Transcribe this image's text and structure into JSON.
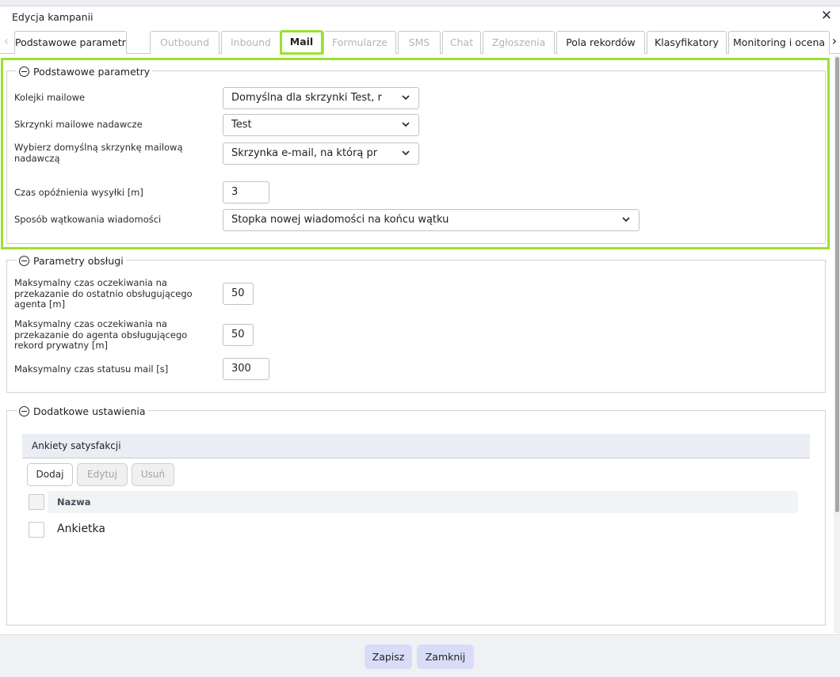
{
  "window": {
    "title": "Edycja kampanii"
  },
  "tabs": [
    {
      "label": "Podstawowe parametry",
      "state": "normal"
    },
    {
      "label": "Outbound",
      "state": "disabled"
    },
    {
      "label": "Inbound",
      "state": "disabled"
    },
    {
      "label": "Mail",
      "state": "active-highlighted"
    },
    {
      "label": "Formularze",
      "state": "disabled"
    },
    {
      "label": "SMS",
      "state": "disabled"
    },
    {
      "label": "Chat",
      "state": "disabled"
    },
    {
      "label": "Zgłoszenia",
      "state": "disabled"
    },
    {
      "label": "Pola rekordów",
      "state": "normal"
    },
    {
      "label": "Klasyfikatory",
      "state": "normal"
    },
    {
      "label": "Monitoring i ocena",
      "state": "normal"
    }
  ],
  "basic": {
    "legend": "Podstawowe parametry",
    "mail_queues_label": "Kolejki mailowe",
    "mail_queues_value": "Domyślna dla skrzynki Test, r",
    "sender_boxes_label": "Skrzynki mailowe nadawcze",
    "sender_boxes_value": "Test",
    "default_box_label_1": "Wybierz domyślną skrzynkę mailową",
    "default_box_label_2": "nadawczą",
    "default_box_value": "Skrzynka e-mail,  na którą pr",
    "delay_label": "Czas opóźnienia wysyłki [m]",
    "delay_value": "3",
    "threading_label": "Sposób wątkowania wiadomości",
    "threading_value": "Stopka nowej wiadomości na końcu wątku"
  },
  "service": {
    "legend": "Parametry obsługi",
    "wait_last_agent_label": [
      "Maksymalny czas oczekiwania na",
      "przekazanie do ostatnio obsługującego",
      "agenta [m]"
    ],
    "wait_last_agent_value": "50",
    "wait_private_label": [
      "Maksymalny czas oczekiwania na",
      "przekazanie do agenta obsługującego",
      "rekord prywatny [m]"
    ],
    "wait_private_value": "50",
    "mail_status_label": "Maksymalny czas statusu mail [s]",
    "mail_status_value": "300"
  },
  "extra": {
    "legend": "Dodatkowe ustawienia",
    "surveys_header": "Ankiety satysfakcji",
    "add_label": "Dodaj",
    "edit_label": "Edytuj",
    "delete_label": "Usuń",
    "column_name": "Nazwa",
    "rows": [
      {
        "name": "Ankietka"
      }
    ]
  },
  "footer": {
    "save_label": "Zapisz",
    "close_label": "Zamknij"
  },
  "colors": {
    "highlight": "#9be22d",
    "footer_button": "#d8dcf7",
    "subheader": "#eaedf3"
  }
}
